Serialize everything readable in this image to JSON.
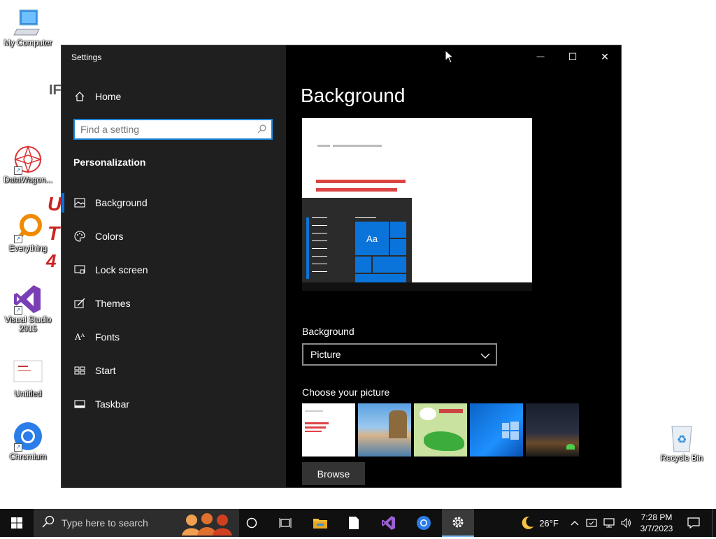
{
  "desktop": {
    "icons": [
      {
        "label": "My Computer"
      },
      {
        "label": "DataWagon..."
      },
      {
        "label": "Everything"
      },
      {
        "label": "Visual Studio 2015"
      },
      {
        "label": "Untitled"
      },
      {
        "label": "Chromium"
      },
      {
        "label": "Recycle Bin"
      }
    ]
  },
  "window": {
    "title": "Settings",
    "controls": {
      "minimize": "—",
      "maximize": "☐",
      "close": "✕"
    }
  },
  "sidebar": {
    "home": "Home",
    "search_placeholder": "Find a setting",
    "section": "Personalization",
    "items": [
      {
        "label": "Background",
        "icon": "picture-icon",
        "selected": true
      },
      {
        "label": "Colors",
        "icon": "palette-icon"
      },
      {
        "label": "Lock screen",
        "icon": "lock-screen-icon"
      },
      {
        "label": "Themes",
        "icon": "brush-icon"
      },
      {
        "label": "Fonts",
        "icon": "font-icon"
      },
      {
        "label": "Start",
        "icon": "start-icon"
      },
      {
        "label": "Taskbar",
        "icon": "taskbar-icon"
      }
    ]
  },
  "main": {
    "heading": "Background",
    "preview": {
      "tile_text": "Aa"
    },
    "background_label": "Background",
    "background_value": "Picture",
    "choose_label": "Choose your picture",
    "browse_label": "Browse"
  },
  "taskbar": {
    "search_text": "Type here to search",
    "weather": "26°F",
    "time": "7:28 PM",
    "date": "3/7/2023"
  },
  "colors": {
    "accent": "#0a74da",
    "sidebar": "#1f1f1f",
    "main": "#000000"
  }
}
